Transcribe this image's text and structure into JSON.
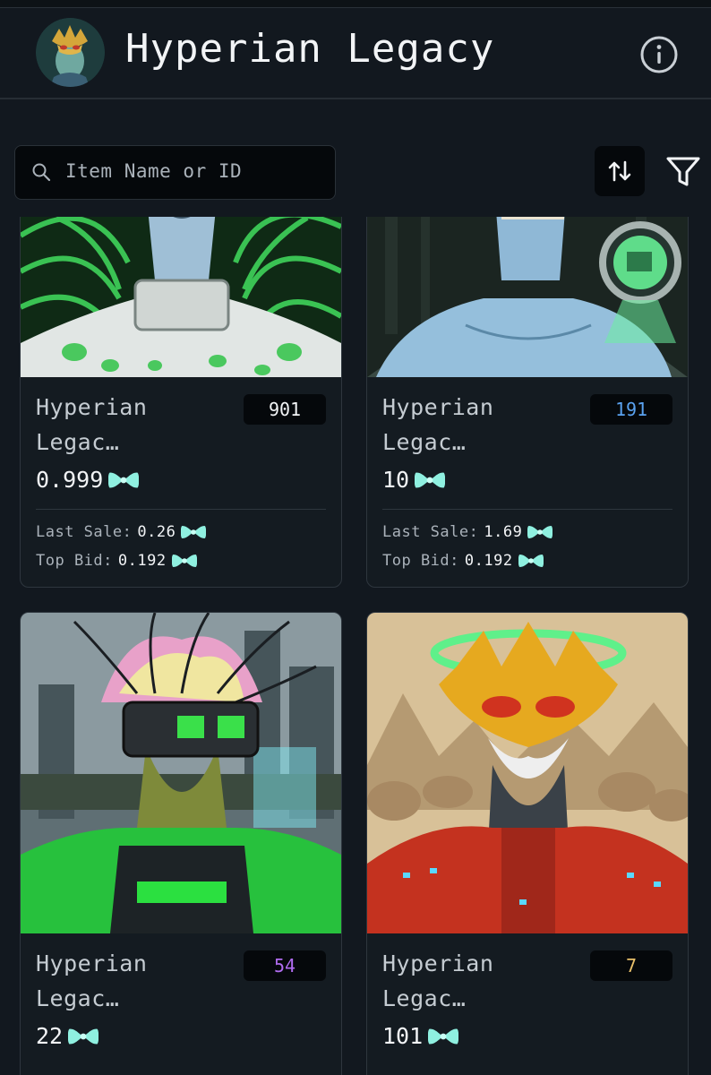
{
  "header": {
    "title": "Hyperian Legacy"
  },
  "search": {
    "placeholder": "Item Name or ID"
  },
  "icons": {
    "search": "search-icon",
    "info": "info-icon",
    "sort": "sort-arrows-icon",
    "filter": "filter-funnel-icon",
    "currency": "token-bowtie-icon"
  },
  "colors": {
    "background": "#12181f",
    "accent_token": "#8ff0e0",
    "badge_blue": "#5aa2f0",
    "badge_purple": "#b06cf0",
    "badge_gold": "#e8c06a"
  },
  "stats_labels": {
    "last_sale": "Last Sale:",
    "top_bid": "Top Bid:"
  },
  "cards": [
    {
      "name": "Hyperian",
      "name2": "Legac…",
      "id": "901",
      "price": "0.999",
      "last_sale": "0.26",
      "top_bid": "0.192"
    },
    {
      "name": "Hyperian",
      "name2": "Legac…",
      "id": "191",
      "price": "10",
      "last_sale": "1.69",
      "top_bid": "0.192"
    },
    {
      "name": "Hyperian",
      "name2": "Legac…",
      "id": "54",
      "price": "22"
    },
    {
      "name": "Hyperian",
      "name2": "Legac…",
      "id": "7",
      "price": "101"
    }
  ]
}
